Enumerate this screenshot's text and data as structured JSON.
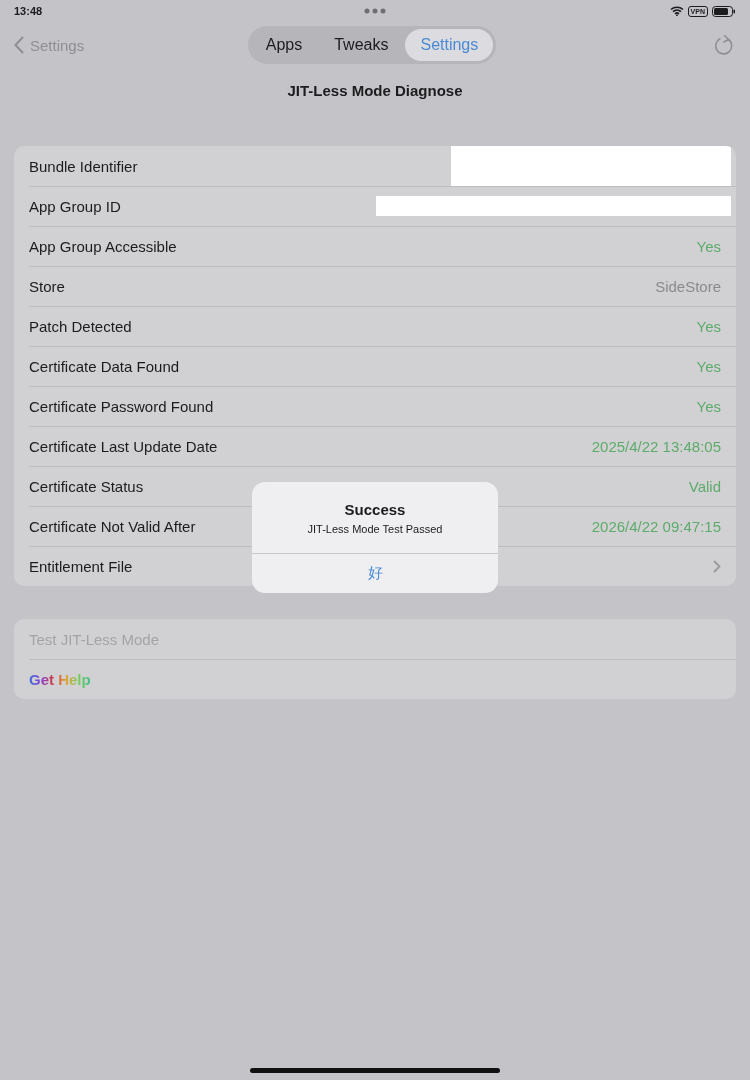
{
  "status_bar": {
    "time": "13:48",
    "vpn": "VPN"
  },
  "nav": {
    "back": "Settings",
    "tabs": [
      {
        "label": "Apps",
        "selected": false
      },
      {
        "label": "Tweaks",
        "selected": false
      },
      {
        "label": "Settings",
        "selected": true
      }
    ]
  },
  "title": "JIT-Less Mode Diagnose",
  "diagnostics": [
    {
      "kind": "redacted",
      "label": "Bundle Identifier"
    },
    {
      "kind": "redacted",
      "label": "App Group ID"
    },
    {
      "kind": "status",
      "label": "App Group Accessible",
      "value": "Yes"
    },
    {
      "kind": "plain",
      "label": "Store",
      "value": "SideStore"
    },
    {
      "kind": "status",
      "label": "Patch Detected",
      "value": "Yes"
    },
    {
      "kind": "status",
      "label": "Certificate Data Found",
      "value": "Yes"
    },
    {
      "kind": "status",
      "label": "Certificate Password Found",
      "value": "Yes"
    },
    {
      "kind": "status",
      "label": "Certificate Last Update Date",
      "value": "2025/4/22 13:48:05"
    },
    {
      "kind": "status",
      "label": "Certificate Status",
      "value": "Valid"
    },
    {
      "kind": "status",
      "label": "Certificate Not Valid After",
      "value": "2026/4/22 09:47:15"
    },
    {
      "kind": "disclosure",
      "label": "Entitlement File"
    }
  ],
  "actions": [
    {
      "kind": "plain",
      "label": "Test JIT-Less Mode",
      "disabled": true
    },
    {
      "kind": "rainbow",
      "label": "Get Help",
      "disabled": false
    }
  ],
  "alert": {
    "title": "Success",
    "message": "JIT-Less Mode Test Passed",
    "button": "好"
  }
}
